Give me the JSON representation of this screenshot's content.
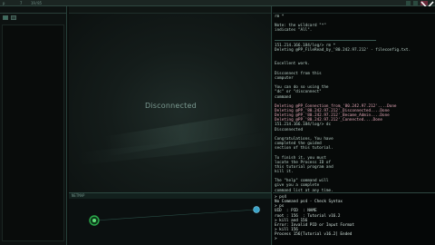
{
  "topbar": {
    "host": "p",
    "ip_short": "7",
    "path": "19/85"
  },
  "left_panel": {
    "title": "",
    "sub": ""
  },
  "display": {
    "panel_label": "",
    "status_text": "Disconnected"
  },
  "netmap": {
    "label": "NETMAP"
  },
  "terminal": {
    "label": "",
    "lines": [
      {
        "text": "rm *",
        "style": "normal"
      },
      {
        "text": "",
        "style": "normal"
      },
      {
        "text": "Note: the wildcard \"*\"",
        "style": "normal"
      },
      {
        "text": "indicates \"All\".",
        "style": "normal"
      },
      {
        "text": "",
        "style": "normal"
      },
      {
        "text": "---------------------",
        "style": "dim"
      },
      {
        "text": "151.214.166.184/log/> rm *",
        "style": "normal"
      },
      {
        "text": "Deleting @PP_FileRead_by_'80.242.97.212' - fileconfig.txt.",
        "style": "normal"
      },
      {
        "text": "",
        "style": "normal"
      },
      {
        "text": "",
        "style": "normal"
      },
      {
        "text": "Excellent work.",
        "style": "normal"
      },
      {
        "text": "",
        "style": "normal"
      },
      {
        "text": "Disconnect from this",
        "style": "normal"
      },
      {
        "text": "computer",
        "style": "normal"
      },
      {
        "text": "",
        "style": "normal"
      },
      {
        "text": "You can do so using the",
        "style": "normal"
      },
      {
        "text": "\"dc\" or \"disconnect\"",
        "style": "normal"
      },
      {
        "text": "command",
        "style": "normal"
      },
      {
        "text": "",
        "style": "normal"
      },
      {
        "text": "Deleting @PP_Connection_from_'80.242.97.212'....Done",
        "style": "hl"
      },
      {
        "text": "Deleting @PP_'80.242.97.212'_Disconnected....Done",
        "style": "hl"
      },
      {
        "text": "Deleting @PP_'80.242.97.212'_Became_Admin....Done",
        "style": "hl"
      },
      {
        "text": "Deleting @PP_'80.242.97.212'_Connected....Done",
        "style": "hl"
      },
      {
        "text": "151.214.166.184/log/> dc",
        "style": "normal"
      },
      {
        "text": "Disconnected",
        "style": "normal"
      },
      {
        "text": "",
        "style": "normal"
      },
      {
        "text": "Congratulations, You have",
        "style": "normal"
      },
      {
        "text": "completed the guided",
        "style": "normal"
      },
      {
        "text": "section of this tutorial.",
        "style": "normal"
      },
      {
        "text": "",
        "style": "normal"
      },
      {
        "text": "To finish it, you must",
        "style": "normal"
      },
      {
        "text": "locate the Process ID of",
        "style": "normal"
      },
      {
        "text": "this tutorial program and",
        "style": "normal"
      },
      {
        "text": "kill it.",
        "style": "normal"
      },
      {
        "text": "",
        "style": "normal"
      },
      {
        "text": "The \"help\" command will",
        "style": "normal"
      },
      {
        "text": "give you a complete",
        "style": "normal"
      },
      {
        "text": "command list at any time.",
        "style": "normal"
      }
    ],
    "input_lines": [
      "> ps4",
      "No Command ps4 - Check Syntax",
      "> ps",
      "UID  : PID  : NAME",
      "root : 156  : Tutorial v16.2",
      "> kill and 156",
      "Error: Invalid PID or Input Format",
      "> kill 156",
      "Process 156[Tutorial v16.2] Ended",
      ">"
    ]
  }
}
